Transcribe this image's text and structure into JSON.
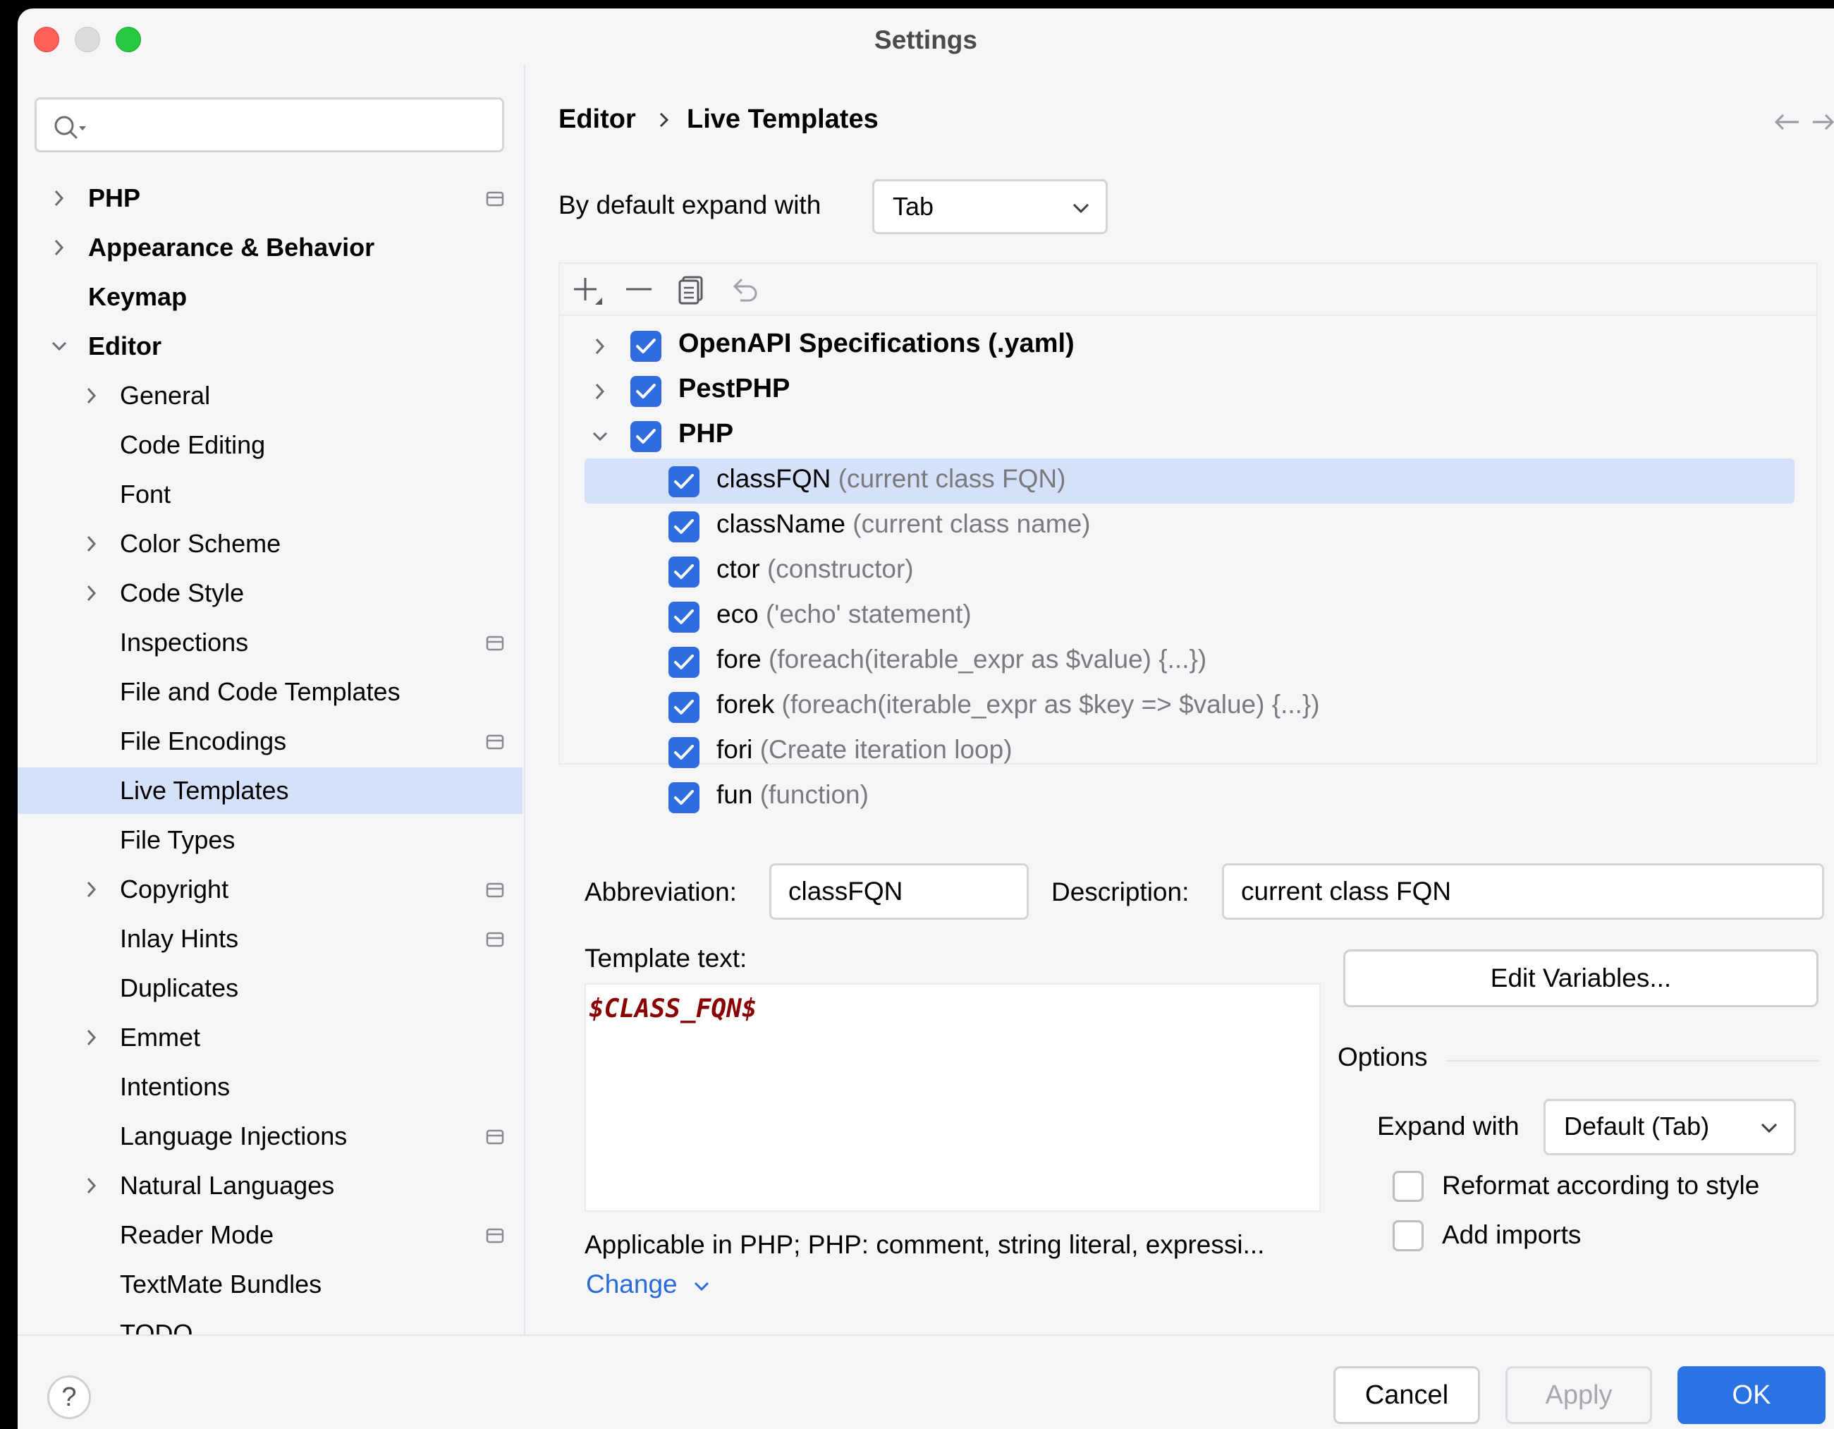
{
  "window": {
    "title": "Settings"
  },
  "colors": {
    "accent": "#2e6cdf",
    "selection": "#d5e1f8",
    "template_text": "#8b0000",
    "link": "#2a6ad8"
  },
  "search": {
    "placeholder": ""
  },
  "sidebar": {
    "items": [
      {
        "label": "PHP",
        "level": 0,
        "chevron": "right",
        "badge": true
      },
      {
        "label": "Appearance & Behavior",
        "level": 0,
        "chevron": "right",
        "badge": false
      },
      {
        "label": "Keymap",
        "level": 0,
        "chevron": "none",
        "badge": false
      },
      {
        "label": "Editor",
        "level": 0,
        "chevron": "down",
        "badge": false
      },
      {
        "label": "General",
        "level": 1,
        "chevron": "right",
        "badge": false
      },
      {
        "label": "Code Editing",
        "level": 1,
        "chevron": "none",
        "badge": false
      },
      {
        "label": "Font",
        "level": 1,
        "chevron": "none",
        "badge": false
      },
      {
        "label": "Color Scheme",
        "level": 1,
        "chevron": "right",
        "badge": false
      },
      {
        "label": "Code Style",
        "level": 1,
        "chevron": "right",
        "badge": false
      },
      {
        "label": "Inspections",
        "level": 1,
        "chevron": "none",
        "badge": true
      },
      {
        "label": "File and Code Templates",
        "level": 1,
        "chevron": "none",
        "badge": false
      },
      {
        "label": "File Encodings",
        "level": 1,
        "chevron": "none",
        "badge": true
      },
      {
        "label": "Live Templates",
        "level": 1,
        "chevron": "none",
        "badge": false,
        "selected": true
      },
      {
        "label": "File Types",
        "level": 1,
        "chevron": "none",
        "badge": false
      },
      {
        "label": "Copyright",
        "level": 1,
        "chevron": "right",
        "badge": true
      },
      {
        "label": "Inlay Hints",
        "level": 1,
        "chevron": "none",
        "badge": true
      },
      {
        "label": "Duplicates",
        "level": 1,
        "chevron": "none",
        "badge": false
      },
      {
        "label": "Emmet",
        "level": 1,
        "chevron": "right",
        "badge": false
      },
      {
        "label": "Intentions",
        "level": 1,
        "chevron": "none",
        "badge": false
      },
      {
        "label": "Language Injections",
        "level": 1,
        "chevron": "none",
        "badge": true
      },
      {
        "label": "Natural Languages",
        "level": 1,
        "chevron": "right",
        "badge": false
      },
      {
        "label": "Reader Mode",
        "level": 1,
        "chevron": "none",
        "badge": true
      },
      {
        "label": "TextMate Bundles",
        "level": 1,
        "chevron": "none",
        "badge": false
      },
      {
        "label": "TODO",
        "level": 1,
        "chevron": "none",
        "badge": false
      }
    ]
  },
  "breadcrumb": {
    "parent": "Editor",
    "current": "Live Templates"
  },
  "expand_default": {
    "label": "By default expand with",
    "value": "Tab"
  },
  "template_tree": {
    "groups": [
      {
        "label": "OpenAPI Specifications (.yaml)",
        "checked": true,
        "expanded": false
      },
      {
        "label": "PestPHP",
        "checked": true,
        "expanded": false
      },
      {
        "label": "PHP",
        "checked": true,
        "expanded": true
      }
    ],
    "items": [
      {
        "name": "classFQN",
        "desc": "(current class FQN)",
        "checked": true,
        "selected": true
      },
      {
        "name": "className",
        "desc": "(current class name)",
        "checked": true
      },
      {
        "name": "ctor",
        "desc": "(constructor)",
        "checked": true
      },
      {
        "name": "eco",
        "desc": "('echo' statement)",
        "checked": true
      },
      {
        "name": "fore",
        "desc": "(foreach(iterable_expr as $value) {...})",
        "checked": true
      },
      {
        "name": "forek",
        "desc": "(foreach(iterable_expr as $key => $value) {...})",
        "checked": true
      },
      {
        "name": "fori",
        "desc": "(Create iteration loop)",
        "checked": true
      },
      {
        "name": "fun",
        "desc": "(function)",
        "checked": true
      }
    ]
  },
  "editor": {
    "abbreviation_label": "Abbreviation:",
    "abbreviation_value": "classFQN",
    "description_label": "Description:",
    "description_value": "current class FQN",
    "template_text_label": "Template text:",
    "template_text": "$CLASS_FQN$",
    "edit_variables": "Edit Variables...",
    "options_label": "Options",
    "expand_with_label": "Expand with",
    "expand_with_value": "Default (Tab)",
    "reformat_label": "Reformat according to style",
    "add_imports_label": "Add imports",
    "applicable": "Applicable in PHP; PHP: comment, string literal, expressi...",
    "change": "Change"
  },
  "footer": {
    "help": "?",
    "cancel": "Cancel",
    "apply": "Apply",
    "ok": "OK"
  }
}
